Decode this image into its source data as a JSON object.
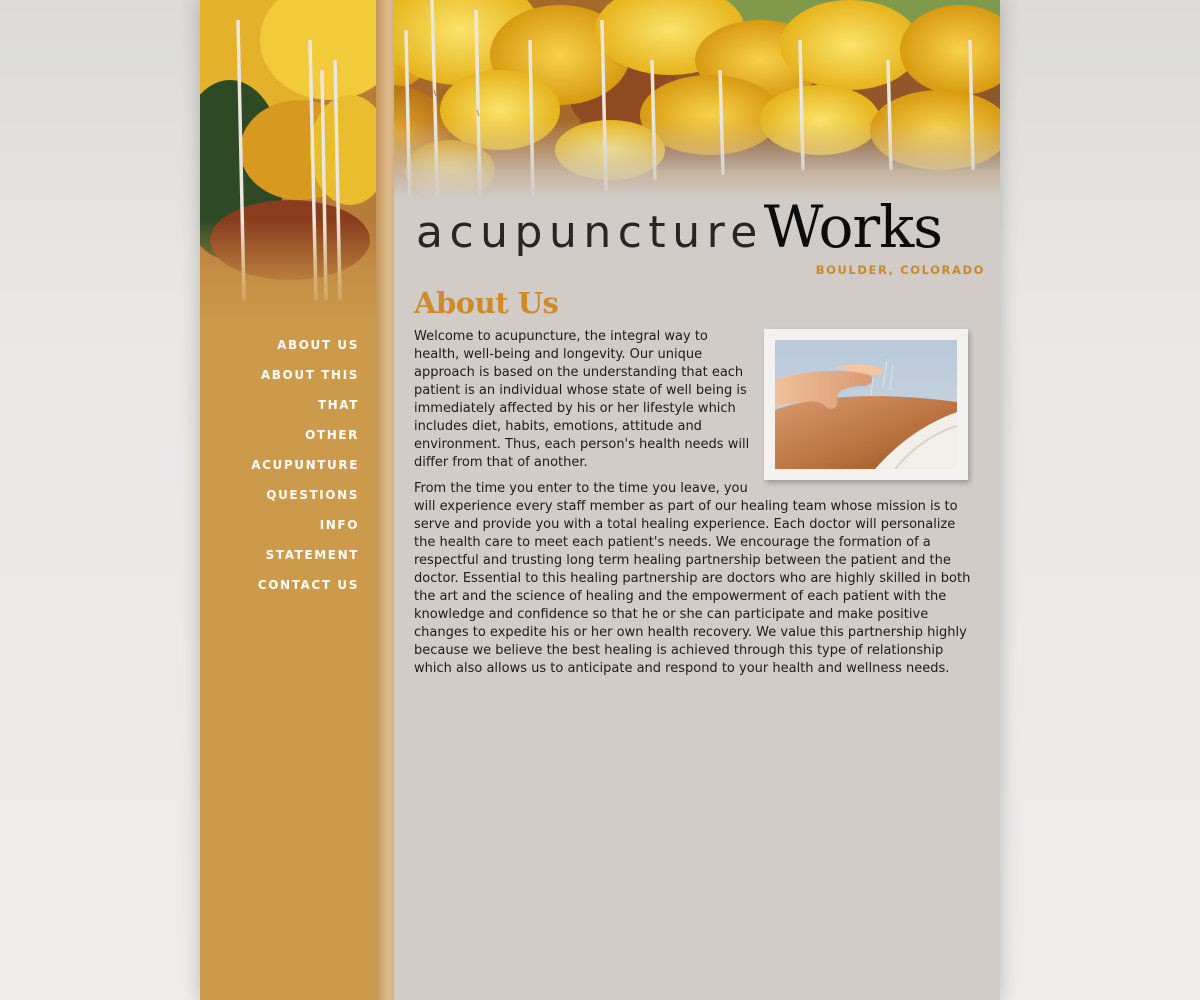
{
  "site": {
    "logo_light": "acupuncture",
    "logo_bold": "Works",
    "location": "BOULDER, COLORADO"
  },
  "nav": {
    "items": [
      {
        "label": "ABOUT US"
      },
      {
        "label": "ABOUT THIS"
      },
      {
        "label": "THAT"
      },
      {
        "label": "OTHER"
      },
      {
        "label": "ACUPUNTURE"
      },
      {
        "label": "QUESTIONS"
      },
      {
        "label": "INFO"
      },
      {
        "label": "STATEMENT"
      },
      {
        "label": "CONTACT US"
      }
    ]
  },
  "main": {
    "title": "About Us",
    "paragraph_1": "Welcome to acupuncture, the integral way to health, well-being and longevity. Our unique approach is based on the understanding that each patient is an individual whose state of well being is immediately affected by his or her lifestyle which includes diet, habits, emotions, attitude and environment. Thus, each person's health needs will differ from that of another.",
    "paragraph_2": "From the time you enter to the time you leave, you will experience every staff member as part of our healing team whose mission is to serve and provide you with a total healing experience. Each doctor will personalize the health care to meet each patient's needs. We encourage the formation of a respectful and trusting long term healing partnership between the patient and the doctor. Essential to this healing partnership are doctors who are highly skilled in both the art and the science of healing and the empowerment of each patient with the knowledge and confidence so that he or she can participate and make positive changes to expedite his or her own health recovery. We value this partnership highly because we believe the best healing is achieved through this type of relationship which also allows us to anticipate and respond to your health and wellness needs."
  },
  "colors": {
    "accent": "#cf8a2a",
    "sidebar": "#cb9a4b",
    "content_bg": "#d1ccc8"
  }
}
